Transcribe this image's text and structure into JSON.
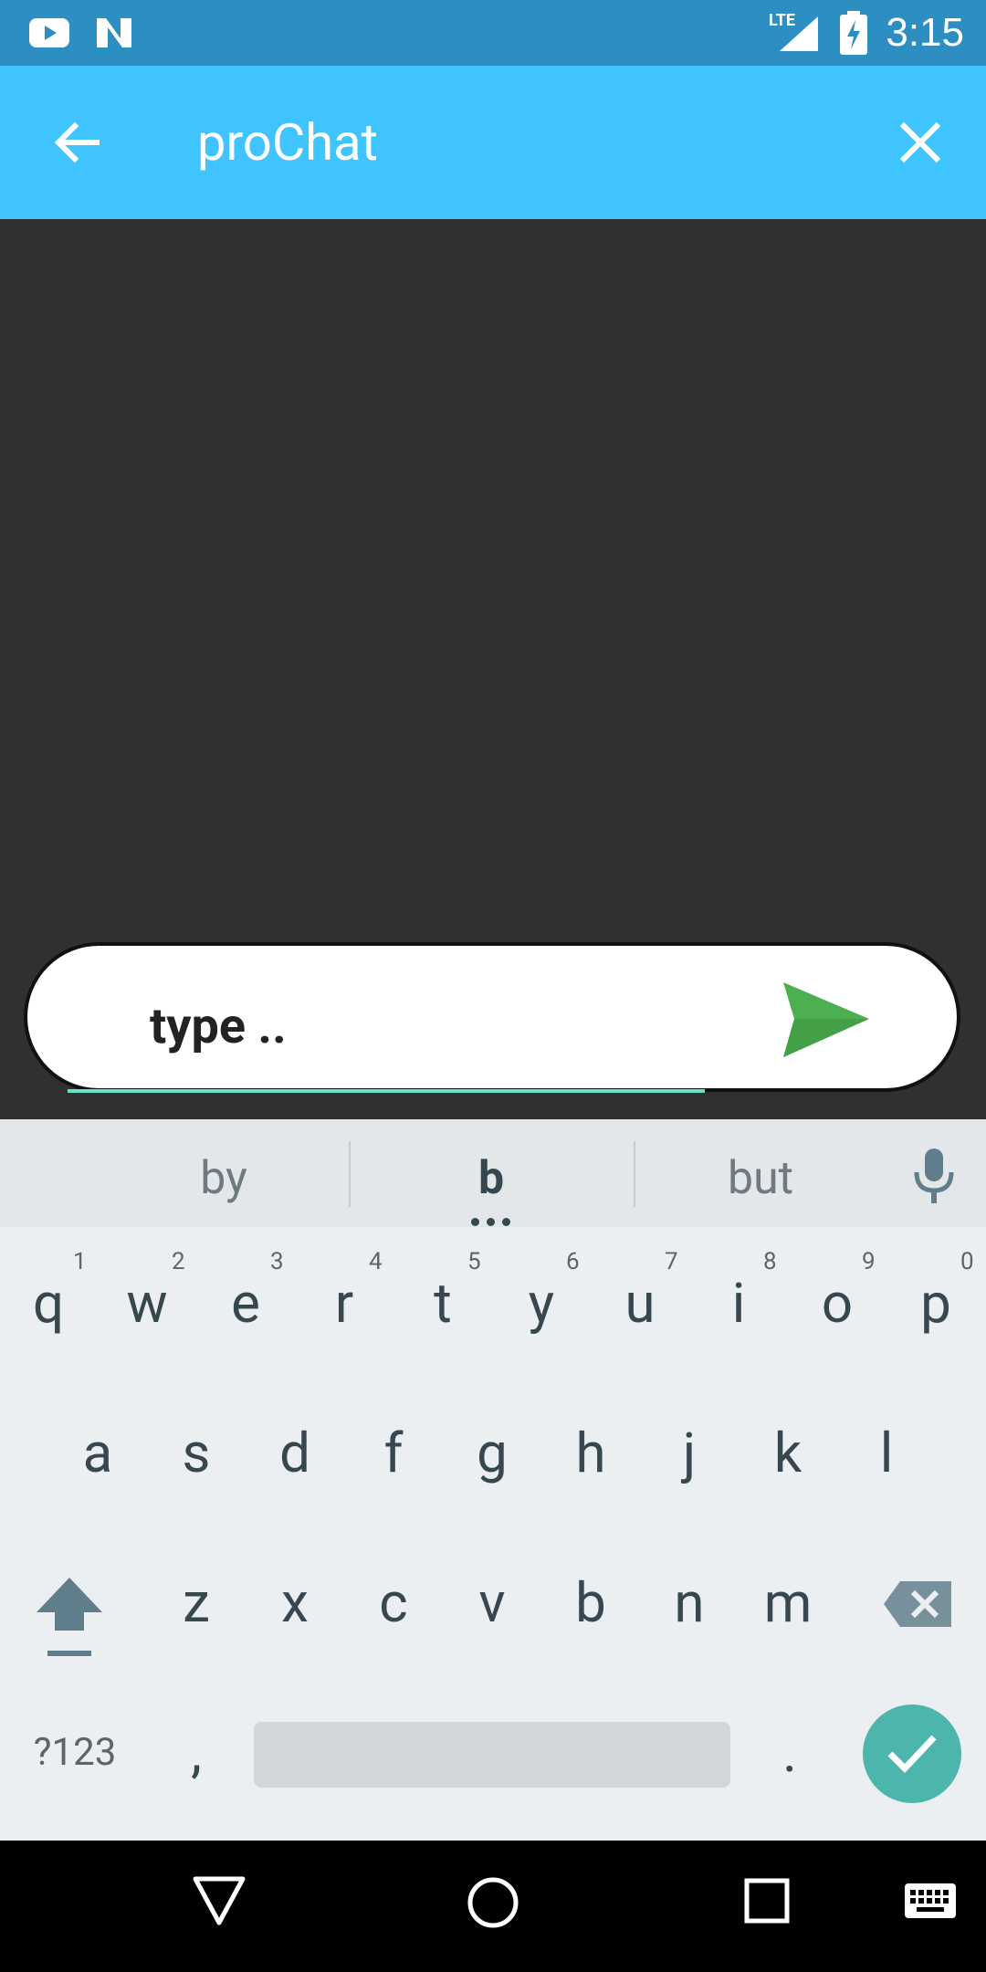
{
  "status_bar": {
    "time": "3:15",
    "network": "LTE"
  },
  "app_bar": {
    "title": "proChat"
  },
  "input": {
    "value": "type .."
  },
  "suggestions": [
    "by",
    "b",
    "but"
  ],
  "keyboard": {
    "row1": [
      {
        "key": "q",
        "hint": "1"
      },
      {
        "key": "w",
        "hint": "2"
      },
      {
        "key": "e",
        "hint": "3"
      },
      {
        "key": "r",
        "hint": "4"
      },
      {
        "key": "t",
        "hint": "5"
      },
      {
        "key": "y",
        "hint": "6"
      },
      {
        "key": "u",
        "hint": "7"
      },
      {
        "key": "i",
        "hint": "8"
      },
      {
        "key": "o",
        "hint": "9"
      },
      {
        "key": "p",
        "hint": "0"
      }
    ],
    "row2": [
      "a",
      "s",
      "d",
      "f",
      "g",
      "h",
      "j",
      "k",
      "l"
    ],
    "row3": [
      "z",
      "x",
      "c",
      "v",
      "b",
      "n",
      "m"
    ],
    "symbols_label": "?123",
    "comma": ",",
    "period": "."
  },
  "colors": {
    "status_bar": "#2d8fc1",
    "app_bar": "#40c4ff",
    "send": "#4caf50",
    "enter_key": "#4db6ac"
  }
}
